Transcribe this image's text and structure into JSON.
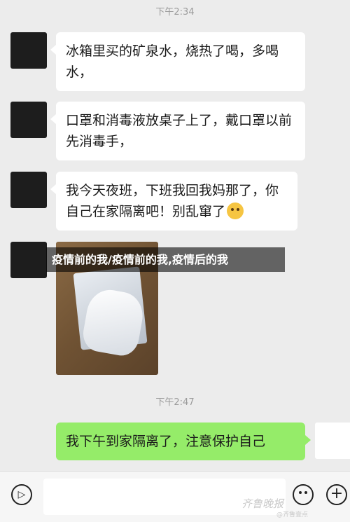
{
  "chat": {
    "timestamp_1": "下午2:34",
    "timestamp_2": "下午2:47",
    "messages": [
      {
        "sender": "other",
        "text": "冰箱里买的矿泉水，烧热了喝，多喝水，"
      },
      {
        "sender": "other",
        "text": "口罩和消毒液放桌子上了，戴口罩以前先消毒手，"
      },
      {
        "sender": "other",
        "text": "我今天夜班，下班我回我妈那了，你自己在家隔离吧！别乱窜了"
      },
      {
        "sender": "self",
        "text": "我下午到家隔离了，注意保护自己"
      }
    ],
    "photo_caption": "疫情前的我/疫情前的我,疫情后的我",
    "emoji_icon": "grimace-emoji-icon"
  },
  "input_bar": {
    "voice_icon": "voice-icon",
    "emoji_icon": "emoji-icon",
    "plus_icon": "plus-icon",
    "placeholder": ""
  },
  "watermark": {
    "text": "齐鲁晚报",
    "sub": "@齐鲁壹点"
  },
  "colors": {
    "background": "#ececec",
    "bubble_other": "#ffffff",
    "bubble_self": "#95ec69"
  }
}
